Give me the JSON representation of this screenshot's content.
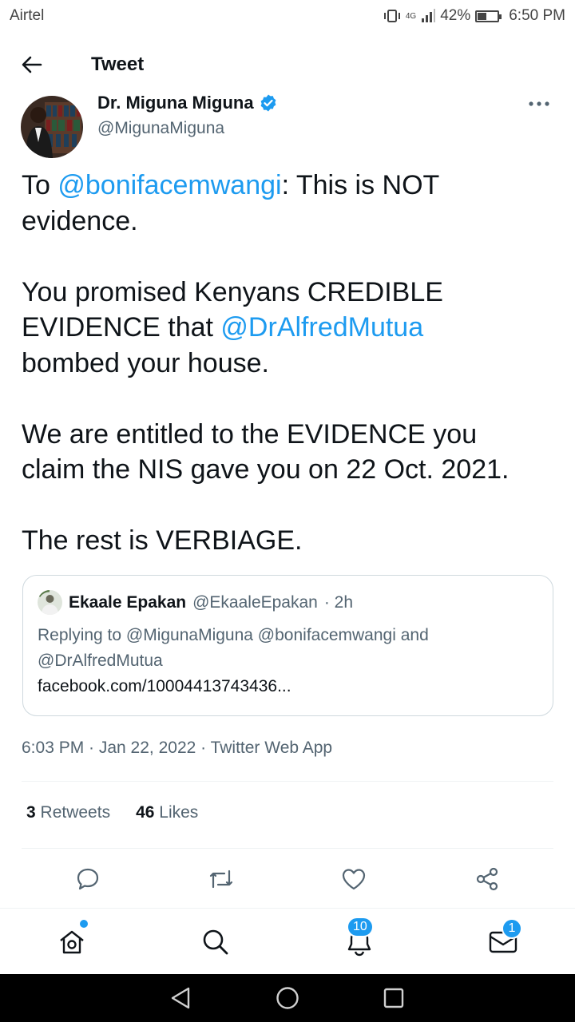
{
  "status_bar": {
    "carrier": "Airtel",
    "network": "4G",
    "battery": "42%",
    "battery_level": 0.42,
    "time": "6:50 PM"
  },
  "header": {
    "title": "Tweet",
    "back_icon": "arrow-left-icon"
  },
  "author": {
    "name": "Dr. Miguna Miguna",
    "handle": "@MigunaMiguna",
    "verified_icon": "verified-badge-icon",
    "more_icon": "more-horizontal-icon"
  },
  "tweet": {
    "segments": [
      {
        "text": "To ",
        "mention": false
      },
      {
        "text": "@bonifacemwangi",
        "mention": true
      },
      {
        "text": ": This is NOT\nevidence.\n\nYou promised Kenyans CREDIBLE\nEVIDENCE that ",
        "mention": false
      },
      {
        "text": "@DrAlfredMutua",
        "mention": true
      },
      {
        "text": "\nbombed your house.\n\nWe are entitled to the EVIDENCE you\nclaim the NIS gave you on 22 Oct. 2021.\n\nThe rest is VERBIAGE.",
        "mention": false
      }
    ]
  },
  "quoted_tweet": {
    "name": "Ekaale Epakan",
    "handle": "@EkaaleEpakan",
    "time": "· 2h",
    "reply_line_1": "Replying to @MigunaMiguna @bonifacemwangi and",
    "reply_line_2": "@DrAlfredMutua",
    "link": "facebook.com/10004413743436..."
  },
  "timestamp": "6:03 PM · Jan 22, 2022 · Twitter Web App",
  "stats": {
    "retweets_count": "3",
    "retweets_label": "Retweets",
    "likes_count": "46",
    "likes_label": "Likes"
  },
  "actions": [
    "reply-icon",
    "retweet-icon",
    "like-icon",
    "share-icon"
  ],
  "bottom_nav": {
    "notifications_badge": "10",
    "messages_badge": "1"
  },
  "colors": {
    "accent": "#1d9bf0",
    "text": "#0f1419",
    "secondary": "#536471",
    "border": "#cfd9de"
  }
}
